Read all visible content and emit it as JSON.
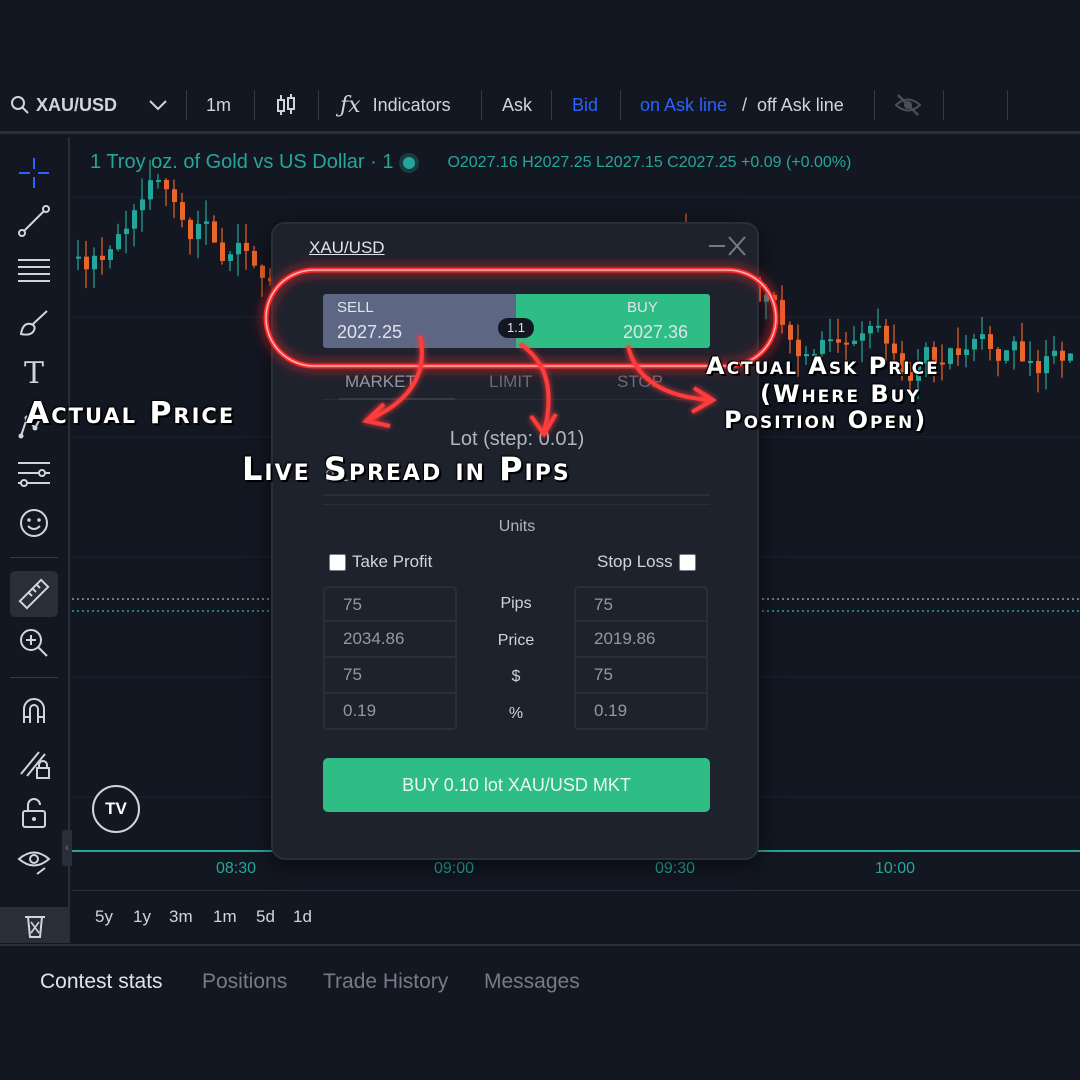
{
  "toolbar": {
    "symbol": "XAU/USD",
    "interval": "1m",
    "indicators": "Indicators",
    "ask": "Ask",
    "bid": "Bid",
    "on_ask_line": "on Ask line",
    "slash": "/",
    "off_ask_line": "off Ask line"
  },
  "legend": {
    "title": "1 Troy oz. of Gold vs US Dollar · 1",
    "ohlc": "O2027.16  H2027.25  L2027.15  C2027.25  +0.09  (+0.00%)"
  },
  "time_axis": [
    "08:30",
    "09:00",
    "09:30",
    "10:00"
  ],
  "ranges": [
    "5y",
    "1y",
    "3m",
    "1m",
    "5d",
    "1d"
  ],
  "bottom_tabs": [
    "Contest stats",
    "Positions",
    "Trade History",
    "Messages"
  ],
  "panel": {
    "title": "XAU/USD",
    "sell_label": "SELL",
    "sell_price": "2027.25",
    "buy_label": "BUY",
    "buy_price": "2027.36",
    "spread": "1.1",
    "tabs": [
      "MARKET",
      "LIMIT",
      "STOP"
    ],
    "lot_label": "Lot (step: 0.01)",
    "lot_value": "0.1",
    "units_label": "Units",
    "take_profit": "Take Profit",
    "stop_loss": "Stop Loss",
    "take_profit_fields": [
      "75",
      "2034.86",
      "75",
      "0.19"
    ],
    "stop_loss_fields": [
      "75",
      "2019.86",
      "75",
      "0.19"
    ],
    "mid_labels": [
      "Pips",
      "Price",
      "$",
      "%"
    ],
    "buy_button": "BUY 0.10 lot XAU/USD MKT"
  },
  "annotations": {
    "actual_price": "Actual Price",
    "live_spread": "Live Spread in Pips",
    "ask_line1": "Actual Ask Price",
    "ask_line2": "(Where Buy",
    "ask_line3": "Position Open)"
  },
  "colors": {
    "up": "#26a69a",
    "down": "#e8652b",
    "sell": "#5d6683",
    "buy": "#2ebd85",
    "highlight": "#ff2a2a"
  },
  "logo": "TV"
}
